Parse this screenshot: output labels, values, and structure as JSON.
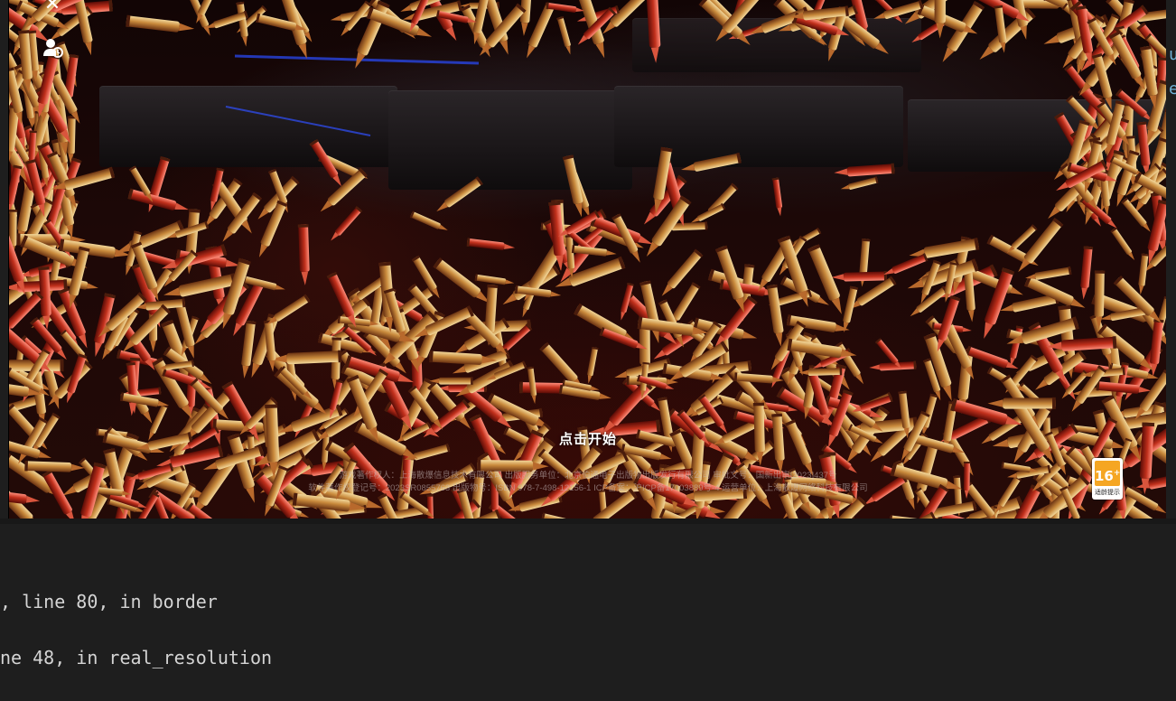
{
  "game": {
    "start_label": "点击开始",
    "copyright_line1": "游戏著作权人：上海散爆信息技术有限公司  出版服务单位：北京伯通电子出版物出版发行有限公司  审批文号：国新出审[2023]437号",
    "copyright_line2": "软件著作权登记号：2023SR0855763  出版物号：ISBN 978-7-498-12156-1  ICP备案：沪ICP备17003889号-4  运营单位：上海散爆网络科技有限公司",
    "age_rating": "16",
    "age_rating_plus": "+",
    "age_caption": "适龄提示"
  },
  "icons": {
    "close": "close-icon",
    "user": "user-account-icon"
  },
  "terminal": {
    "line1": ", line 80, in border",
    "line2": "ne 48, in real_resolution",
    "right_edge_chars": [
      "u",
      "e"
    ]
  }
}
